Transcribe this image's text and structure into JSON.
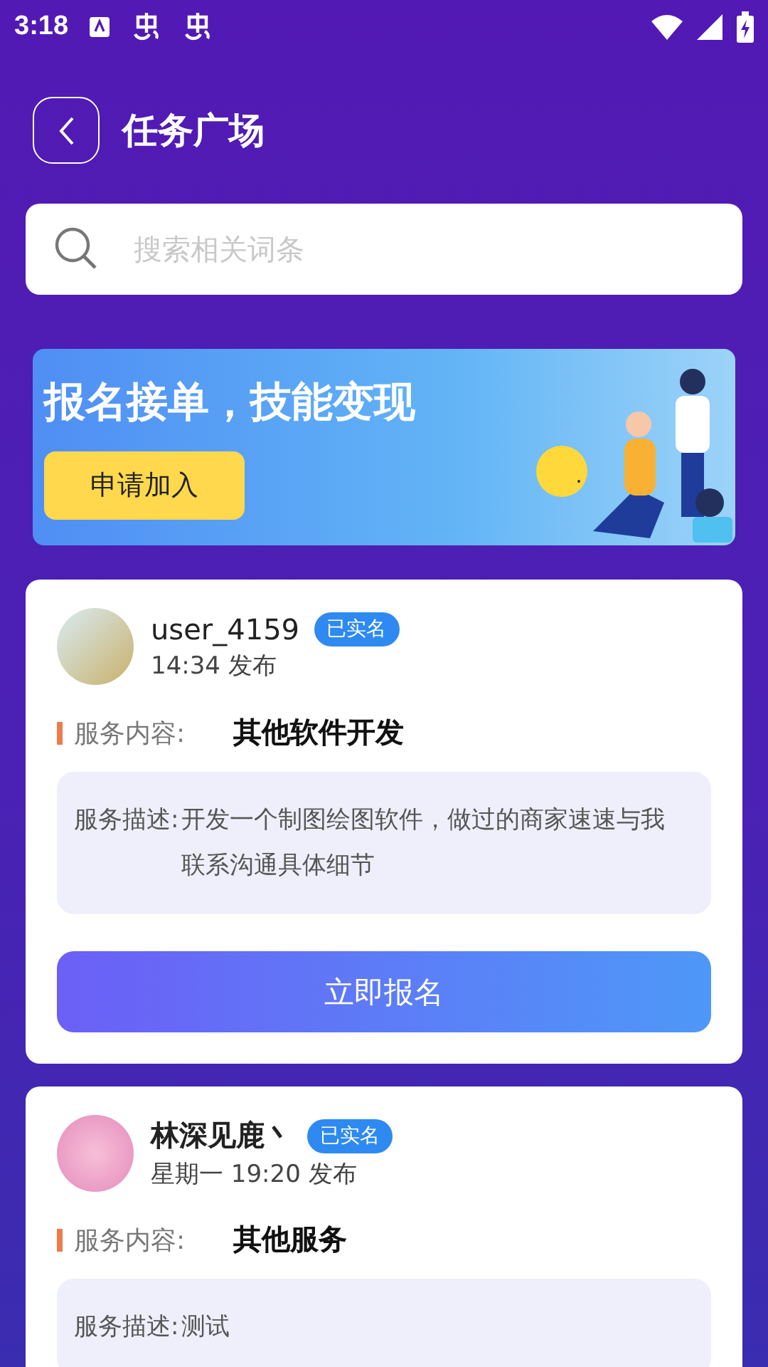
{
  "status_bar": {
    "time": "3:18"
  },
  "header": {
    "title": "任务广场"
  },
  "search": {
    "placeholder": "搜索相关词条"
  },
  "banner": {
    "headline": "报名接单，技能变现",
    "button": "申请加入"
  },
  "tasks": [
    {
      "name": "user_4159",
      "name_bold": false,
      "verified": true,
      "badge": "已实名",
      "posted": "14:34 发布",
      "content_label": "服务内容:",
      "content": "其他软件开发",
      "desc_label": "服务描述:",
      "desc": "开发一个制图绘图软件，做过的商家速速与我联系沟通具体细节",
      "button": "立即报名"
    },
    {
      "name": "林深见鹿丶",
      "name_bold": true,
      "verified": true,
      "badge": "已实名",
      "posted": "星期一 19:20 发布",
      "content_label": "服务内容:",
      "content": "其他服务",
      "desc_label": "服务描述:",
      "desc": "测试"
    }
  ]
}
